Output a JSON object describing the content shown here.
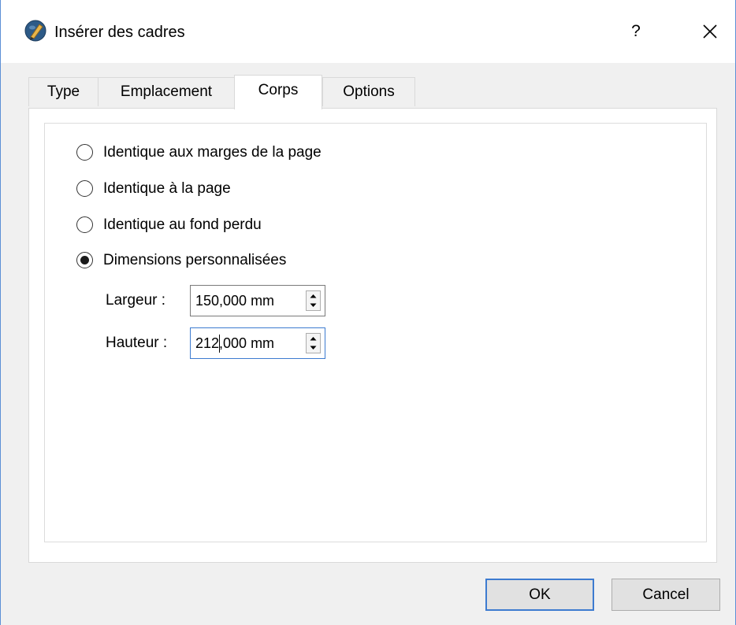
{
  "window": {
    "title": "Insérer des cadres",
    "help_label": "?",
    "app_icon": "scribus-pen-icon",
    "close_icon": "close-icon"
  },
  "tabs": [
    {
      "label": "Type",
      "active": false
    },
    {
      "label": "Emplacement",
      "active": false
    },
    {
      "label": "Corps",
      "active": true
    },
    {
      "label": "Options",
      "active": false
    }
  ],
  "size_options": [
    {
      "label": "Identique aux marges de la page",
      "checked": false
    },
    {
      "label": "Identique à la page",
      "checked": false
    },
    {
      "label": "Identique au fond perdu",
      "checked": false
    },
    {
      "label": "Dimensions personnalisées",
      "checked": true
    }
  ],
  "fields": {
    "width": {
      "label": "Largeur :",
      "value": "150,000 mm"
    },
    "height": {
      "label": "Hauteur :",
      "value": "212,000 mm",
      "focused": true
    }
  },
  "buttons": {
    "ok": "OK",
    "cancel": "Cancel"
  },
  "colors": {
    "accent": "#3d7bd0",
    "window_border": "#5c8fd6"
  }
}
